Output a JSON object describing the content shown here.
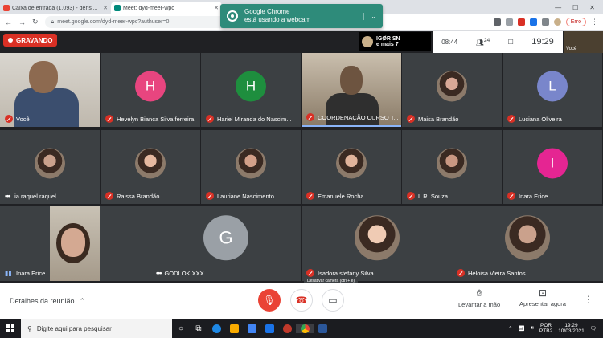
{
  "browser": {
    "tabs": [
      {
        "title": "Caixa de entrada (1.093) - dens ...",
        "favicon_color": "#ea4335"
      },
      {
        "title": "Meet: dyd-meer-wpc",
        "favicon_color": "#00897b",
        "active": true
      },
      {
        "title": "",
        "favicon_color": "#d93025"
      }
    ],
    "url": "meet.google.com/dyd-meer-wpc?authuser=0",
    "error_badge": "Erro"
  },
  "notification": {
    "line1": "Google Chrome",
    "line2": "está usando a webcam"
  },
  "meet": {
    "recording_label": "GRAVANDO",
    "presenter_label": "IGØR SN",
    "presenter_sub": "e mais 7",
    "time_left": "08:44",
    "participants_count": "24",
    "clock": "19:29",
    "self_thumb_label": "Você",
    "hover_tooltip": "Desativar câmera (ctrl + e)"
  },
  "participants": [
    {
      "name": "Você",
      "muted": true,
      "kind": "video-me"
    },
    {
      "name": "Hevelyn Bianca Silva ferreira",
      "muted": true,
      "kind": "letter",
      "letter": "H",
      "color": "#e8457f"
    },
    {
      "name": "Hariel Miranda do Nascim...",
      "muted": true,
      "kind": "letter",
      "letter": "H",
      "color": "#1e8e3e"
    },
    {
      "name": "COORDENAÇÃO CURSO T...",
      "muted": true,
      "kind": "video-coord"
    },
    {
      "name": "Maisa Brandão",
      "muted": true,
      "kind": "photo"
    },
    {
      "name": "Luciana Oliveira",
      "muted": true,
      "kind": "letter",
      "letter": "L",
      "color": "#7986cb"
    },
    {
      "name": "lia raquel raquel",
      "muted": false,
      "kind": "photo"
    },
    {
      "name": "Raissa Brandão",
      "muted": true,
      "kind": "photo"
    },
    {
      "name": "Lauriane Nascimento",
      "muted": true,
      "kind": "photo"
    },
    {
      "name": "Emanuele Rocha",
      "muted": true,
      "kind": "photo"
    },
    {
      "name": "L.R. Souza",
      "muted": true,
      "kind": "photo"
    },
    {
      "name": "Inara Erice",
      "muted": true,
      "kind": "letter",
      "letter": "I",
      "color": "#e52592"
    },
    {
      "name": "Inara Erice",
      "muted": false,
      "kind": "video-inara"
    },
    {
      "name": "GODLOK XXX",
      "muted": false,
      "kind": "letter",
      "letter": "G",
      "color": "#9aa0a6"
    },
    {
      "name": "Isadora stefany Silva",
      "muted": true,
      "kind": "photo"
    },
    {
      "name": "Heloisa Vieira Santos",
      "muted": true,
      "kind": "photo"
    }
  ],
  "bottom_bar": {
    "details_label": "Detalhes da reunião",
    "raise_hand_label": "Levantar a mão",
    "present_label": "Apresentar agora"
  },
  "taskbar": {
    "search_placeholder": "Digite aqui para pesquisar",
    "lang": "POR",
    "lang_sub": "PTB2",
    "time": "19:29",
    "date": "10/03/2021"
  },
  "colors": {
    "meet_bg": "#202124",
    "tile_bg": "#3c4043",
    "danger": "#d93025",
    "notification": "#2e8b7a"
  }
}
